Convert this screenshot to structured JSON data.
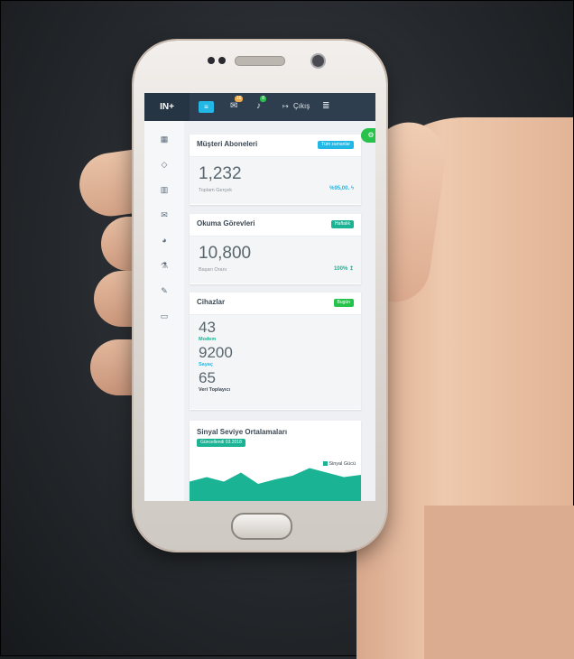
{
  "app": {
    "brand": "IN+"
  },
  "topbar": {
    "menu_icon": "menu-icon",
    "mail_badge": "16",
    "bell_badge": "8",
    "logout_label": "Çıkış",
    "colors": {
      "bar": "#2e3e4e",
      "accent": "#23b7e5",
      "mail_badge": "#f0ad4e",
      "bell_badge": "#27c24c"
    }
  },
  "sidebar": {
    "items": [
      {
        "icon": "dashboard-icon",
        "glyph": "▦"
      },
      {
        "icon": "diamond-icon",
        "glyph": "◇"
      },
      {
        "icon": "bar-chart-icon",
        "glyph": "▥"
      },
      {
        "icon": "envelope-icon",
        "glyph": "✉"
      },
      {
        "icon": "pie-chart-icon",
        "glyph": "◕"
      },
      {
        "icon": "flask-icon",
        "glyph": "⚗"
      },
      {
        "icon": "edit-icon",
        "glyph": "✎"
      },
      {
        "icon": "desktop-icon",
        "glyph": "▭"
      }
    ]
  },
  "cards": {
    "subscribers": {
      "title": "Müşteri Aboneleri",
      "tag": "Tüm zamanlar",
      "value": "1,232",
      "label": "Toplam Gerçek",
      "trend": "%95,00."
    },
    "reading_tasks": {
      "title": "Okuma Görevleri",
      "tag": "Haftalık",
      "value": "10,800",
      "label": "Başarı Oranı",
      "trend": "100%"
    },
    "devices": {
      "title": "Cihazlar",
      "tag": "Bugün",
      "items": [
        {
          "value": "43",
          "label": "Modem",
          "color": "#1ab394"
        },
        {
          "value": "9200",
          "label": "Sayaç",
          "color": "#23b7e5"
        },
        {
          "value": "65",
          "label": "Veri Toplayıcı",
          "color": "#3b4752"
        }
      ]
    },
    "signal": {
      "title": "Sinyal Seviye Ortalamaları",
      "updated": "Güncellendi 03.2018",
      "legend": "Sinyal Gücü"
    }
  },
  "chart_data": {
    "type": "area",
    "title": "Sinyal Seviye Ortalamaları",
    "legend": "Sinyal Gücü",
    "series": [
      {
        "name": "Sinyal Gücü",
        "values": [
          0.55,
          0.45,
          0.55,
          0.35,
          0.6,
          0.5,
          0.42,
          0.25,
          0.35,
          0.45,
          0.4
        ]
      }
    ]
  }
}
